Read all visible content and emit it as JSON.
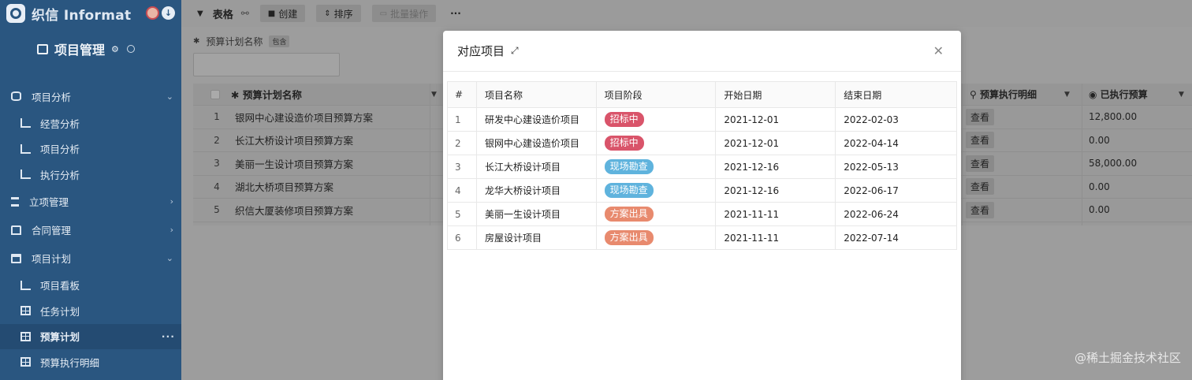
{
  "brand": {
    "name": "织信 Informat"
  },
  "project": {
    "title": "项目管理"
  },
  "nav": [
    {
      "label": "项目分析",
      "kind": "group",
      "icon": "database-icon",
      "chevron": "⌄"
    },
    {
      "label": "经营分析",
      "kind": "sub",
      "icon": "line-chart-icon"
    },
    {
      "label": "项目分析",
      "kind": "sub",
      "icon": "line-chart-icon"
    },
    {
      "label": "执行分析",
      "kind": "sub",
      "icon": "line-chart-icon"
    },
    {
      "label": "立项管理",
      "kind": "group",
      "icon": "hourglass-icon",
      "chevron": "›"
    },
    {
      "label": "合同管理",
      "kind": "group",
      "icon": "home-icon",
      "chevron": "›"
    },
    {
      "label": "项目计划",
      "kind": "group",
      "icon": "calendar-icon",
      "chevron": "⌄"
    },
    {
      "label": "项目看板",
      "kind": "sub",
      "icon": "line-chart-icon"
    },
    {
      "label": "任务计划",
      "kind": "sub",
      "icon": "grid-icon"
    },
    {
      "label": "预算计划",
      "kind": "sub",
      "icon": "grid-icon",
      "active": true
    },
    {
      "label": "预算执行明细",
      "kind": "sub",
      "icon": "grid-icon"
    }
  ],
  "toolbar": {
    "title": "表格",
    "create": "创建",
    "sort": "排序",
    "batch": "批量操作",
    "more": "···"
  },
  "filter": {
    "label": "预算计划名称",
    "tag": "包含"
  },
  "bg_table": {
    "header": {
      "name": "预算计划名称",
      "view": "预算执行明细",
      "exec": "已执行预算"
    },
    "rows": [
      {
        "num": "1",
        "name": "银网中心建设造价项目预算方案",
        "view": "查看",
        "exec": "12,800.00"
      },
      {
        "num": "2",
        "name": "长江大桥设计项目预算方案",
        "view": "查看",
        "exec": "0.00"
      },
      {
        "num": "3",
        "name": "美丽一生设计项目预算方案",
        "view": "查看",
        "exec": "58,000.00"
      },
      {
        "num": "4",
        "name": "湖北大桥项目预算方案",
        "view": "查看",
        "exec": "0.00"
      },
      {
        "num": "5",
        "name": "织信大厦装修项目预算方案",
        "view": "查看",
        "exec": "0.00"
      }
    ]
  },
  "modal": {
    "title": "对应项目",
    "columns": [
      "#",
      "项目名称",
      "项目阶段",
      "开始日期",
      "结束日期"
    ],
    "rows": [
      {
        "num": "1",
        "name": "研发中心建设造价项目",
        "stage": "招标中",
        "stage_color": "#d9546a",
        "start": "2021-12-01",
        "end": "2022-02-03"
      },
      {
        "num": "2",
        "name": "银网中心建设造价项目",
        "stage": "招标中",
        "stage_color": "#d9546a",
        "start": "2021-12-01",
        "end": "2022-04-14"
      },
      {
        "num": "3",
        "name": "长江大桥设计项目",
        "stage": "现场勘查",
        "stage_color": "#5fb3dd",
        "start": "2021-12-16",
        "end": "2022-05-13"
      },
      {
        "num": "4",
        "name": "龙华大桥设计项目",
        "stage": "现场勘查",
        "stage_color": "#5fb3dd",
        "start": "2021-12-16",
        "end": "2022-06-17"
      },
      {
        "num": "5",
        "name": "美丽一生设计项目",
        "stage": "方案出具",
        "stage_color": "#e88a6e",
        "start": "2021-11-11",
        "end": "2022-06-24"
      },
      {
        "num": "6",
        "name": "房屋设计项目",
        "stage": "方案出具",
        "stage_color": "#e88a6e",
        "start": "2021-11-11",
        "end": "2022-07-14"
      }
    ]
  },
  "watermark": "@稀土掘金技术社区"
}
